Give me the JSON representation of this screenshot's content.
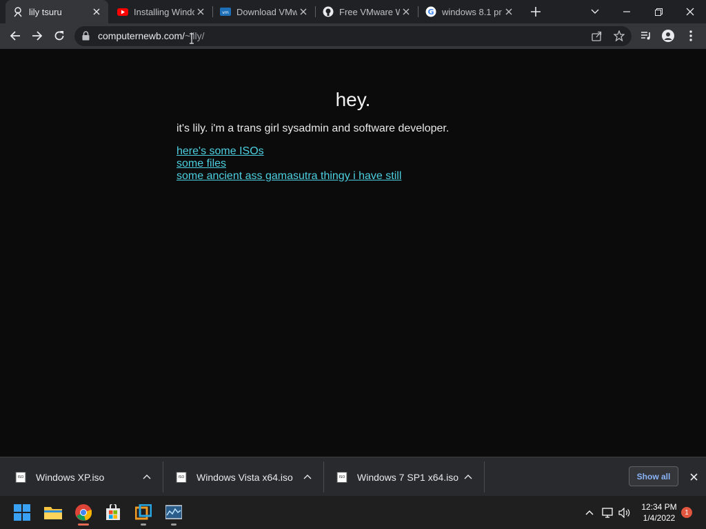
{
  "browser": {
    "tabs": [
      {
        "title": "lily tsuru",
        "favicon": "lily-favicon-icon",
        "active": true
      },
      {
        "title": "Installing Windo",
        "favicon": "youtube-icon",
        "active": false
      },
      {
        "title": "Download VMw",
        "favicon": "vmware-icon",
        "active": false
      },
      {
        "title": "Free VMware W",
        "favicon": "github-icon",
        "active": false
      },
      {
        "title": "windows 8.1 pr",
        "favicon": "google-icon",
        "active": false
      }
    ],
    "url_domain": "computernewb.com/",
    "url_path": "~lily/"
  },
  "page": {
    "heading": "hey.",
    "intro": "it's lily. i'm a trans girl sysadmin and software developer.",
    "links": [
      "here's some ISOs",
      "some files",
      "some ancient ass gamasutra thingy i have still"
    ],
    "link_color": "#4dd0e1"
  },
  "downloads": {
    "items": [
      "Windows XP.iso",
      "Windows Vista x64.iso",
      "Windows 7 SP1 x64.iso"
    ],
    "show_all_label": "Show all"
  },
  "taskbar": {
    "apps": [
      "start-icon",
      "file-explorer-icon",
      "chrome-icon",
      "microsoft-store-icon",
      "vmware-icon",
      "resource-monitor-icon"
    ],
    "time": "12:34 PM",
    "date": "1/4/2022",
    "notification_count": "1"
  },
  "colors": {
    "accent": "#e66b55",
    "tab_active": "#35363a",
    "tabstrip": "#202124"
  }
}
